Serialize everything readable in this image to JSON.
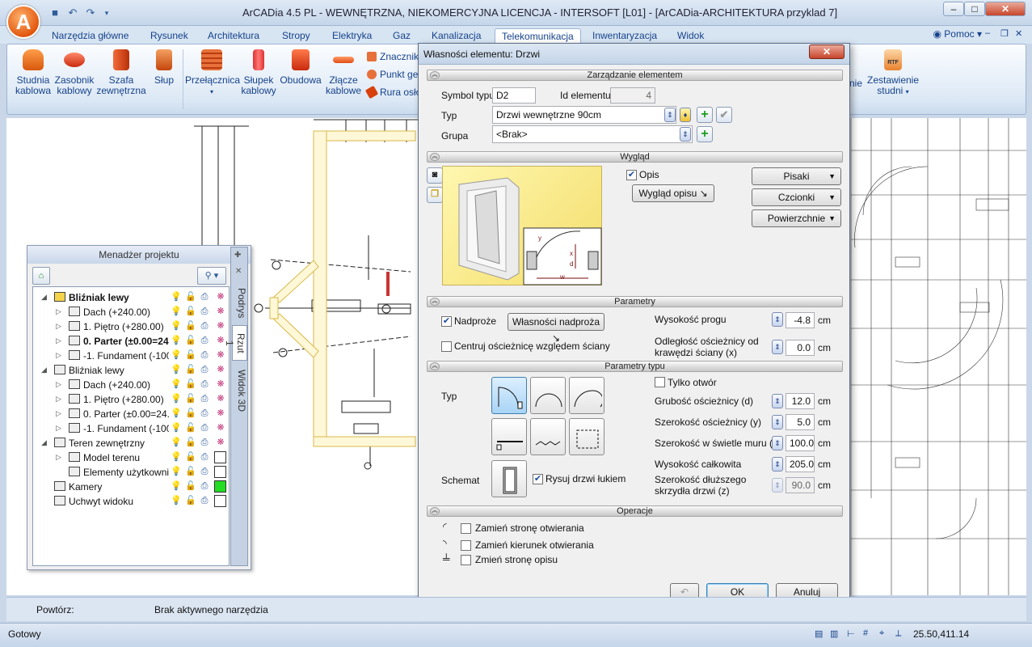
{
  "app": {
    "title": "ArCADia 4.5 PL - WEWNĘTRZNA, NIEKOMERCYJNA LICENCJA - INTERSOFT [L01] - [ArCADia-ARCHITEKTURA przyklad 7]",
    "logo_letter": "A"
  },
  "ribbon_tabs": [
    "Narzędzia główne",
    "Rysunek",
    "Architektura",
    "Stropy",
    "Elektryka",
    "Gaz",
    "Kanalizacja",
    "Telekomunikacja",
    "Inwentaryzacja",
    "Widok"
  ],
  "active_tab": "Telekomunikacja",
  "help_label": "Pomoc",
  "ribbon": {
    "buttons": [
      {
        "label": "Studnia kablowa"
      },
      {
        "label": "Zasobnik kablowy"
      },
      {
        "label": "Szafa zewnętrzna"
      },
      {
        "label": "Słup"
      },
      {
        "label": "Przełącznica"
      },
      {
        "label": "Słupek kablowy"
      },
      {
        "label": "Obudowa"
      },
      {
        "label": "Złącze kablowe"
      }
    ],
    "small_buttons": [
      "Znacznik",
      "Punkt ge",
      "Rura osło"
    ],
    "right_partial": "nie",
    "report_button": "Zestawienie studni",
    "report_icon_text": "RTF"
  },
  "project_manager": {
    "title": "Menadżer projektu",
    "tree": [
      {
        "label": "Bliźniak lewy",
        "bold": true,
        "level": 0,
        "expanded": true,
        "swatch": null
      },
      {
        "label": "Dach (+240.00)",
        "bold": false,
        "level": 1,
        "expanded": false,
        "swatch": null
      },
      {
        "label": "1. Piętro (+280.00)",
        "bold": false,
        "level": 1,
        "expanded": false,
        "swatch": null
      },
      {
        "label": "0. Parter (±0.00=24...",
        "bold": true,
        "level": 1,
        "expanded": false,
        "swatch": null
      },
      {
        "label": "-1. Fundament (-100...",
        "bold": false,
        "level": 1,
        "expanded": false,
        "swatch": null
      },
      {
        "label": "Bliźniak lewy",
        "bold": false,
        "level": 0,
        "expanded": true,
        "swatch": null
      },
      {
        "label": "Dach (+240.00)",
        "bold": false,
        "level": 1,
        "expanded": false,
        "swatch": null
      },
      {
        "label": "1. Piętro (+280.00)",
        "bold": false,
        "level": 1,
        "expanded": false,
        "swatch": null
      },
      {
        "label": "0. Parter (±0.00=24...",
        "bold": false,
        "level": 1,
        "expanded": false,
        "swatch": null
      },
      {
        "label": "-1. Fundament (-100...",
        "bold": false,
        "level": 1,
        "expanded": false,
        "swatch": null
      },
      {
        "label": "Teren zewnętrzny",
        "bold": false,
        "level": 0,
        "expanded": true,
        "swatch": null
      },
      {
        "label": "Model terenu",
        "bold": false,
        "level": 1,
        "expanded": false,
        "swatch": "#ffffff"
      },
      {
        "label": "Elementy użytkowni...",
        "bold": false,
        "level": 1,
        "expanded": null,
        "swatch": "#ffffff"
      },
      {
        "label": "Kamery",
        "bold": false,
        "level": 0,
        "expanded": null,
        "swatch": "#22dd22"
      },
      {
        "label": "Uchwyt widoku",
        "bold": false,
        "level": 0,
        "expanded": null,
        "swatch": "#ffffff"
      }
    ],
    "side_tabs": [
      "Podrys",
      "Rzut 1",
      "Widok 3D"
    ]
  },
  "dialog": {
    "title": "Własności elementu: Drzwi",
    "sections": {
      "management": "Zarządzanie elementem",
      "appearance": "Wygląd",
      "parameters": "Parametry",
      "type_parameters": "Parametry typu",
      "operations": "Operacje"
    },
    "symbol_label": "Symbol typu",
    "symbol_value": "D2",
    "id_label": "Id elementu",
    "id_value": "4",
    "type_label": "Typ",
    "type_value": "Drzwi wewnętrzne 90cm",
    "group_label": "Grupa",
    "group_value": "<Brak>",
    "opis_label": "Opis",
    "opis_checked": true,
    "wyglad_opisu_btn": "Wygląd opisu",
    "pisaki_btn": "Pisaki",
    "czcionki_btn": "Czcionki",
    "powierzchnie_btn": "Powierzchnie",
    "diagram_labels": [
      "y",
      "x",
      "d",
      "w"
    ],
    "nadproze_label": "Nadproże",
    "nadproze_checked": true,
    "wlasnosci_nadproza_btn": "Własności nadproża",
    "centruj_label": "Centruj ościeżnicę względem ściany",
    "centruj_checked": false,
    "wysokosc_progu_label": "Wysokość progu",
    "wysokosc_progu_value": "-4.8",
    "odleglosc_label": "Odległość ościeżnicy od krawędzi ściany (x)",
    "odleglosc_value": "0.0",
    "unit": "cm",
    "typ_label": "Typ",
    "tylko_otwor_label": "Tylko otwór",
    "tylko_otwor_checked": false,
    "grubosc_label": "Grubość ościeżnicy (d)",
    "grubosc_value": "12.0",
    "szer_osc_label": "Szerokość ościeżnicy (y)",
    "szer_osc_value": "5.0",
    "szer_swietle_label": "Szerokość w świetle muru (w)",
    "szer_swietle_value": "100.0",
    "wys_calk_label": "Wysokość całkowita",
    "wys_calk_value": "205.0",
    "szer_skrzydla_label": "Szerokość dłuższego skrzydła drzwi (z)",
    "szer_skrzydla_value": "90.0",
    "schemat_label": "Schemat",
    "rysuj_label": "Rysuj drzwi łukiem",
    "rysuj_checked": true,
    "operations": [
      {
        "label": "Zamień stronę otwierania"
      },
      {
        "label": "Zamień kierunek otwierania"
      },
      {
        "label": "Zmień stronę opisu"
      }
    ],
    "ok_btn": "OK",
    "cancel_btn": "Anuluj"
  },
  "command_bar": {
    "repeat_label": "Powtórz:",
    "status": "Brak aktywnego narzędzia"
  },
  "status_bar": {
    "left": "Gotowy",
    "coords": "25.50,411.14"
  }
}
